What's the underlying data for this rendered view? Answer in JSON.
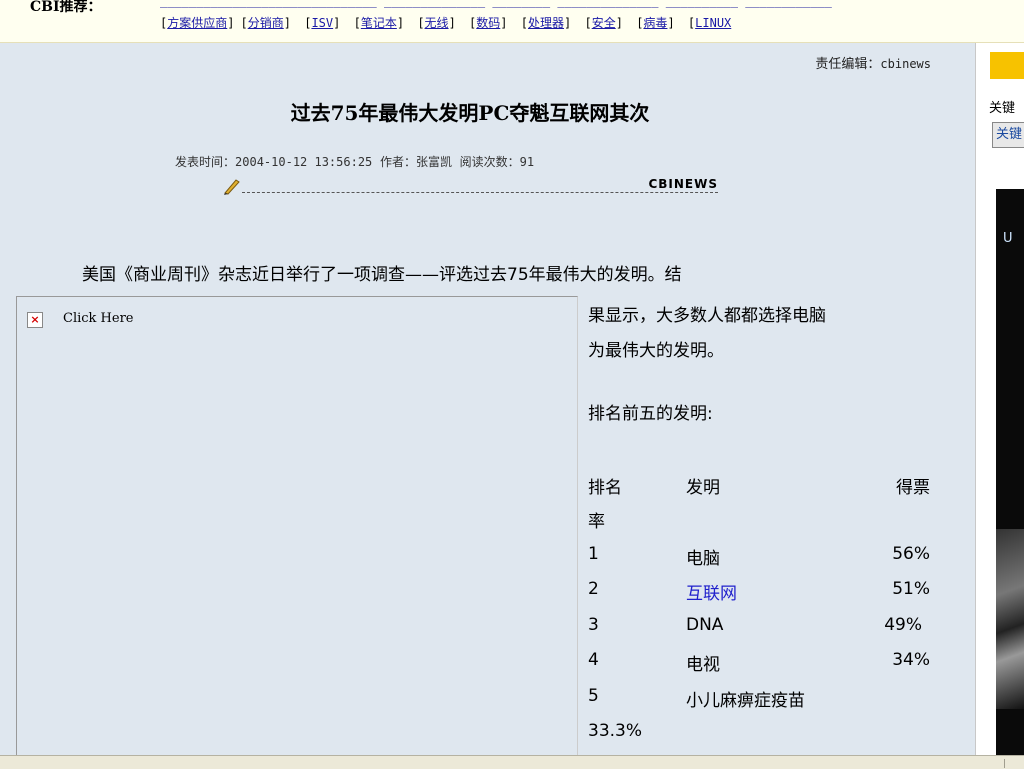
{
  "top_bar": {
    "label": "CBI推荐：",
    "links": [
      {
        "text": "方案供应商"
      },
      {
        "text": "分销商"
      },
      {
        "text": "ISV"
      },
      {
        "text": "笔记本"
      },
      {
        "text": "无线"
      },
      {
        "text": "数码"
      },
      {
        "text": "处理器"
      },
      {
        "text": "安全"
      },
      {
        "text": "病毒"
      },
      {
        "text": "LINUX"
      }
    ]
  },
  "article": {
    "editor_label": "责任编辑：",
    "editor_value": "cbinews",
    "title": "过去75年最伟大发明PC夺魁互联网其次",
    "meta": {
      "date_label": "发表时间：",
      "date_value": "2004-10-12 13:56:25",
      "author_label": "作者：",
      "author_value": "张富凯",
      "reads_label": "阅读次数：",
      "reads_value": "91"
    },
    "divider_brand": "CBINEWS",
    "intro_line": "美国《商业周刊》杂志近日举行了一项调查——评选过去75年最伟大的发明。结",
    "body_lines": [
      "果显示，大多数人都都选择电脑",
      "为最伟大的发明。"
    ],
    "subheading": "排名前五的发明:",
    "table_header": {
      "rank": "排名",
      "rank_wrap": "率",
      "invention": "发明",
      "votes": "得票"
    },
    "rows": [
      {
        "rank": "1",
        "invention": "电脑",
        "votes": "56%"
      },
      {
        "rank": "2",
        "invention": "互联网",
        "votes": "51%"
      },
      {
        "rank": "3",
        "invention": "DNA",
        "votes": "49%"
      },
      {
        "rank": "4",
        "invention": "电视",
        "votes": "34%"
      },
      {
        "rank": "5",
        "invention": "小儿麻痹症疫苗",
        "votes": "33.3%"
      }
    ],
    "ad_caption": "Click Here"
  },
  "sidebar": {
    "keyword_label": "关键",
    "button_label": "关键",
    "image_letter": "U"
  }
}
